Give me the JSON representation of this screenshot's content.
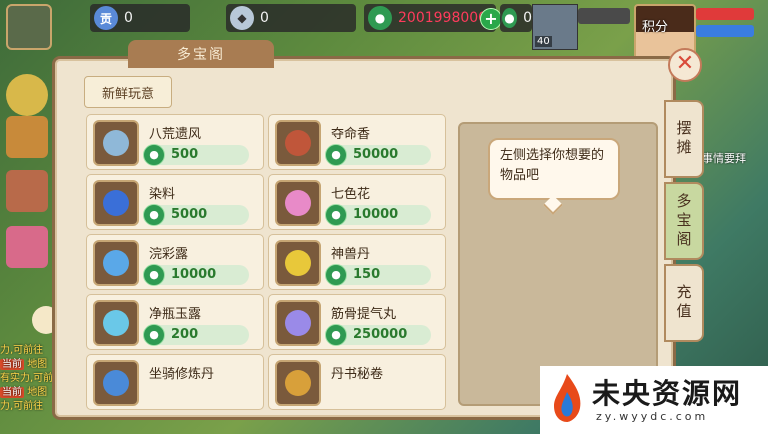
{
  "top": {
    "currency1_icon": "贡",
    "currency1_value": "0",
    "currency2_value": "0",
    "currency3_value": "2001998000",
    "currency4_value": "0",
    "pet_level": "40",
    "avatar_label": "积分"
  },
  "modal": {
    "title": "多宝阁",
    "category_tab": "新鲜玩意",
    "prompt": "左侧选择你想要的物品吧",
    "tabs": [
      "摆摊",
      "多宝阁",
      "充值"
    ],
    "items": [
      {
        "name": "八荒遗风",
        "price": "500",
        "color": "#8fb8d8"
      },
      {
        "name": "夺命香",
        "price": "50000",
        "color": "#c0563a"
      },
      {
        "name": "染料",
        "price": "5000",
        "color": "#3a6fd8"
      },
      {
        "name": "七色花",
        "price": "10000",
        "color": "#e88ac8"
      },
      {
        "name": "浣彩露",
        "price": "10000",
        "color": "#5aa8e8"
      },
      {
        "name": "神兽丹",
        "price": "150",
        "color": "#e8c83a"
      },
      {
        "name": "净瓶玉露",
        "price": "200",
        "color": "#6ac8e8"
      },
      {
        "name": "筋骨提气丸",
        "price": "250000",
        "color": "#9a8ae8"
      },
      {
        "name": "坐骑修炼丹",
        "price": "",
        "color": "#4a8ad8"
      },
      {
        "name": "丹书秘卷",
        "price": "",
        "color": "#d8a03a"
      }
    ]
  },
  "side": {
    "note": "事情要拜",
    "chat": [
      {
        "tag": "",
        "text": "力,可前往"
      },
      {
        "tag": "当前",
        "text": "地图"
      },
      {
        "tag": "",
        "text": "有实力,可前往"
      },
      {
        "tag": "当前",
        "text": "地图"
      },
      {
        "tag": "",
        "text": "力,可前往"
      }
    ]
  },
  "watermark": {
    "title": "未央资源网",
    "url": "zy.wyydc.com"
  },
  "colors": {
    "price_green": "#2a7a2e",
    "panel": "#efe4cf",
    "frame": "#8a6a46"
  }
}
